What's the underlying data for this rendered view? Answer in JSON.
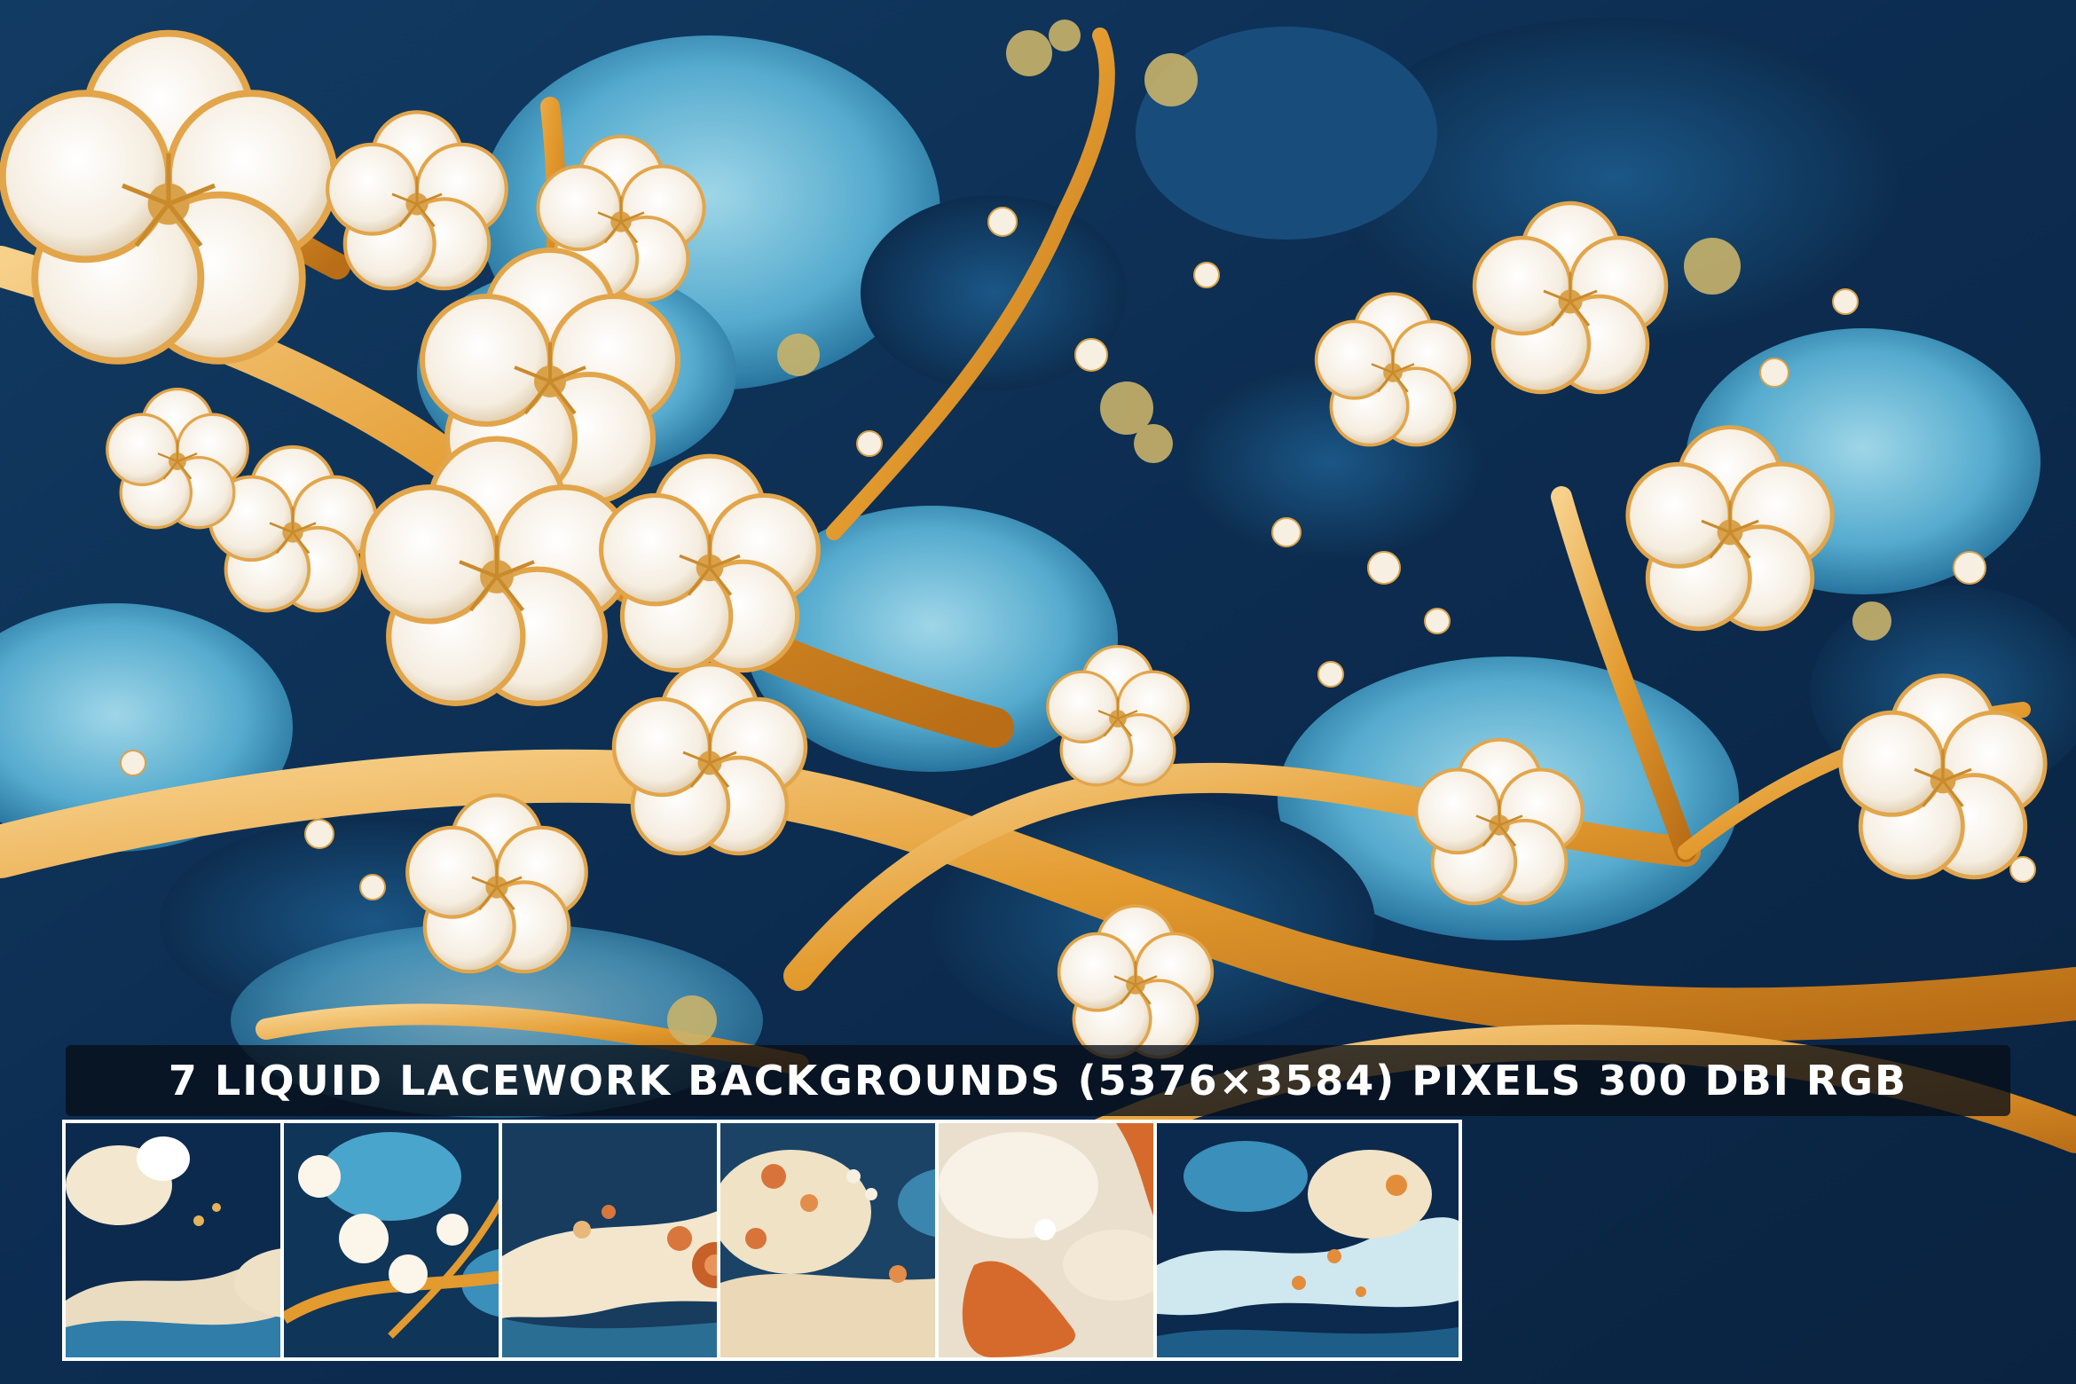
{
  "banner": {
    "title": "7 LIQUID LACEWORK BACKGROUNDS (5376×3584) PIXELS 300 DBI RGB"
  },
  "colors": {
    "deep_blue": "#0b2a4a",
    "teal": "#2f8fb8",
    "light_aqua": "#7cc8e0",
    "gold": "#e8a53a",
    "cream": "#f6efe2",
    "copper": "#d06a30"
  },
  "thumbnails": [
    {
      "name": "thumbnail-1",
      "palette": "navy-cream-waves"
    },
    {
      "name": "thumbnail-2",
      "palette": "gold-branches-white-flowers"
    },
    {
      "name": "thumbnail-3",
      "palette": "cream-wave-copper-flowers"
    },
    {
      "name": "thumbnail-4",
      "palette": "orange-cream-pearls"
    },
    {
      "name": "thumbnail-5",
      "palette": "orange-cream-coral"
    },
    {
      "name": "thumbnail-6",
      "palette": "blue-teal-orange-pearls"
    }
  ]
}
